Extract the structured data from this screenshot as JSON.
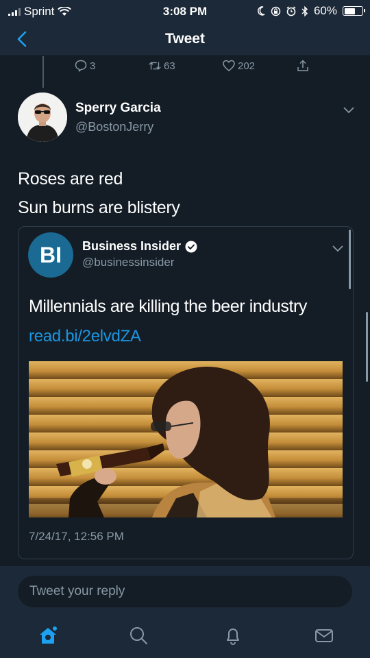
{
  "status_bar": {
    "carrier": "Sprint",
    "time": "3:08 PM",
    "battery": "60%",
    "battery_level": 0.6,
    "icons": [
      "signal-icon",
      "wifi-icon",
      "moon-icon",
      "lock-rotation-icon",
      "alarm-icon",
      "bluetooth-icon",
      "battery-icon"
    ]
  },
  "nav": {
    "title": "Tweet",
    "back_icon": "chevron-left-icon"
  },
  "parent_actions": {
    "reply_count": "3",
    "retweet_count": "63",
    "like_count": "202",
    "icons": [
      "reply-icon",
      "retweet-icon",
      "heart-icon",
      "share-icon"
    ]
  },
  "tweet": {
    "author_name": "Sperry Garcia",
    "author_handle": "@BostonJerry",
    "lines": [
      "Roses are red",
      "Sun burns are blistery"
    ]
  },
  "quoted": {
    "logo_text": "BI",
    "name": "Business Insider",
    "handle": "@businessinsider",
    "text": "Millennials are killing the beer industry",
    "link": "read.bi/2elvdZA",
    "date": "7/24/17, 12:56 PM",
    "icons": [
      "verified-badge-icon",
      "chevron-down-icon"
    ]
  },
  "reply": {
    "placeholder": "Tweet your reply"
  },
  "tabs": [
    "home-icon",
    "search-icon",
    "notifications-icon",
    "messages-icon"
  ],
  "colors": {
    "background": "#141d26",
    "bar": "#1c2938",
    "accent": "#1da1f2",
    "link": "#1b95e0",
    "muted": "#8899a6",
    "bi_logo": "#1a6a93"
  }
}
